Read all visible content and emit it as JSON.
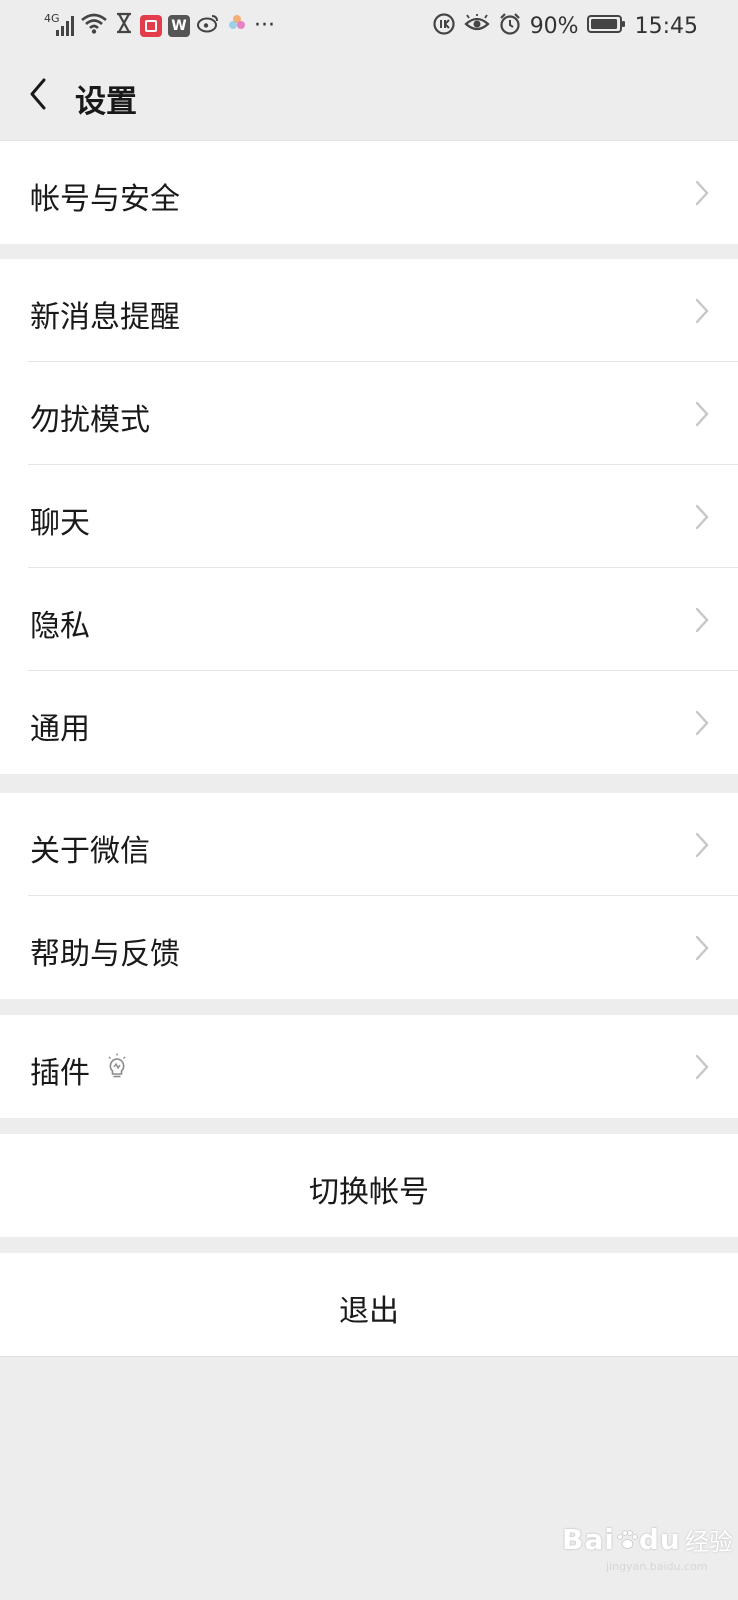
{
  "status_bar": {
    "network": "4G",
    "battery_percent": "90%",
    "battery_level": 0.9,
    "time": "15:45",
    "more": "···",
    "notification_icons": [
      "signal-icon",
      "wifi-icon",
      "hourglass-icon",
      "red-app-icon",
      "w-app-icon",
      "weibo-icon",
      "photos-app-icon",
      "more-dots-icon"
    ],
    "system_icons": [
      "data-saver-icon",
      "eye-comfort-icon",
      "alarm-icon",
      "battery-icon"
    ]
  },
  "header": {
    "title": "设置",
    "back_icon": "chevron-left-icon"
  },
  "groups": {
    "g1": {
      "items": [
        {
          "label": "帐号与安全"
        }
      ]
    },
    "g2": {
      "items": [
        {
          "label": "新消息提醒"
        },
        {
          "label": "勿扰模式"
        },
        {
          "label": "聊天"
        },
        {
          "label": "隐私"
        },
        {
          "label": "通用"
        }
      ]
    },
    "g3": {
      "items": [
        {
          "label": "关于微信"
        },
        {
          "label": "帮助与反馈"
        }
      ]
    },
    "g4": {
      "items": [
        {
          "label": "插件",
          "badge_icon": "lightbulb-icon"
        }
      ]
    }
  },
  "actions": {
    "switch_account": "切换帐号",
    "logout": "退出"
  },
  "watermark": {
    "brand": "Bai",
    "brand_suffix": "du",
    "cn": "经验",
    "url": "jingyan.baidu.com"
  },
  "colors": {
    "background": "#ededed",
    "cell": "#ffffff",
    "text": "#191919",
    "chevron": "#c7c7c7",
    "divider": "#e5e5e5"
  }
}
